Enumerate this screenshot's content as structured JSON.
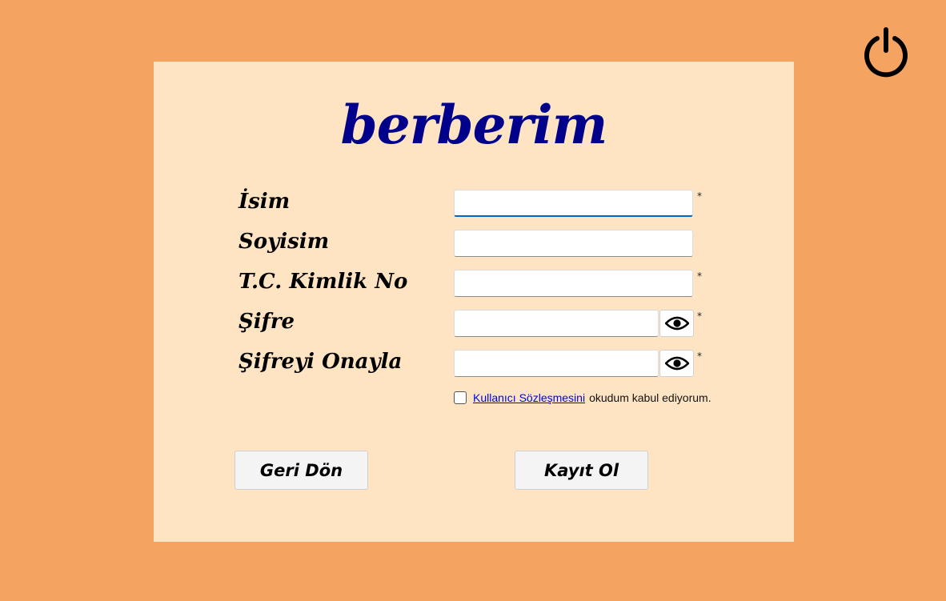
{
  "app": {
    "logo": "berberim"
  },
  "header": {
    "power_icon": "power-icon"
  },
  "form": {
    "fields": [
      {
        "label": "İsim",
        "value": "",
        "placeholder": "",
        "required_mark": "*"
      },
      {
        "label": "Soyisim",
        "value": "",
        "placeholder": "",
        "required_mark": ""
      },
      {
        "label": "T.C. Kimlik No",
        "value": "",
        "placeholder": "",
        "required_mark": "*"
      },
      {
        "label": "Şifre",
        "value": "",
        "placeholder": "",
        "required_mark": "*",
        "icon": "eye-icon"
      },
      {
        "label": "Şifreyi Onayla",
        "value": "",
        "placeholder": "",
        "required_mark": "*",
        "icon": "eye-icon"
      }
    ],
    "agreement": {
      "checked": false,
      "link_text": "Kullanıcı Sözleşmesini",
      "suffix_text": "okudum kabul ediyorum."
    }
  },
  "buttons": {
    "back_label": "Geri Dön",
    "register_label": "Kayıt Ol"
  },
  "colors": {
    "background": "#F4A460",
    "panel": "#FFE4C4",
    "logo": "#00008B",
    "link": "#0000EE",
    "focus": "#0067C0"
  }
}
